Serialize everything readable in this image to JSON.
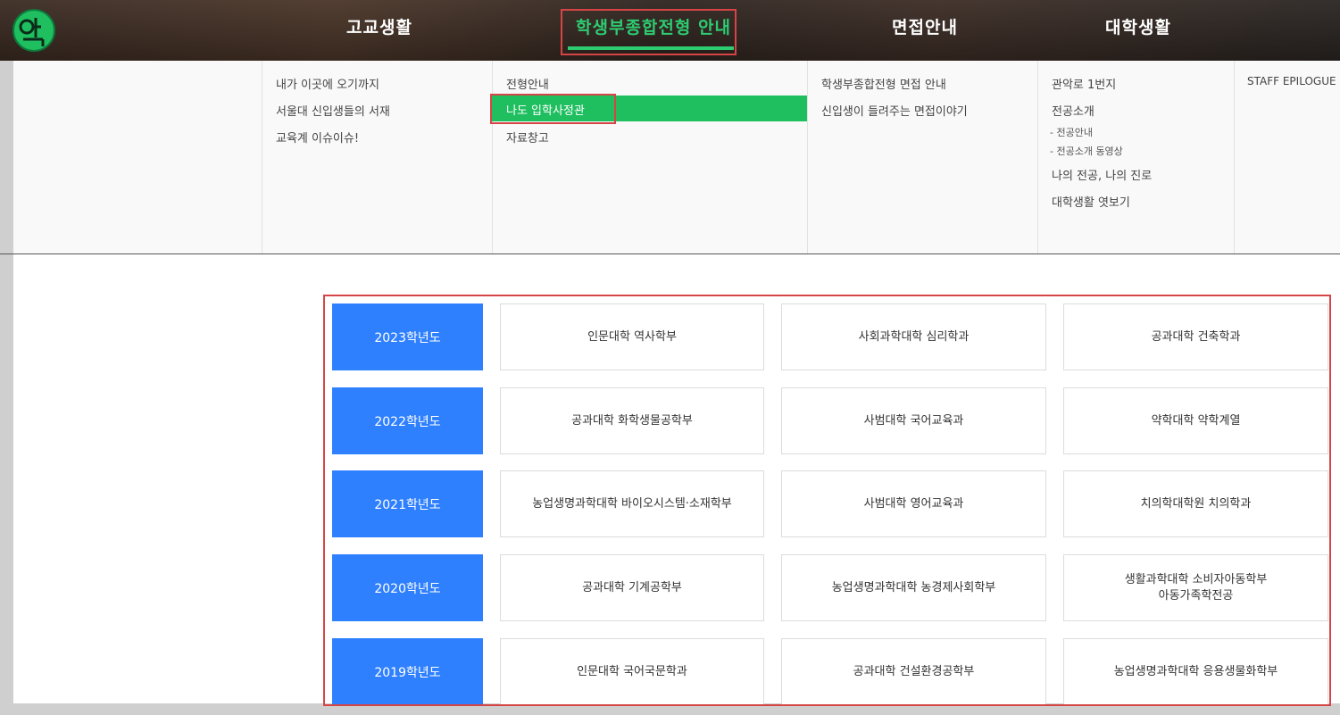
{
  "nav": {
    "items": [
      {
        "label": "고교생활"
      },
      {
        "label": "학생부종합전형 안내"
      },
      {
        "label": "면접안내"
      },
      {
        "label": "대학생활"
      }
    ]
  },
  "dropdown": {
    "col1": [
      "내가 이곳에 오기까지",
      "서울대 신입생들의 서재",
      "교육계 이슈이슈!"
    ],
    "col2": [
      "전형안내",
      "나도 입학사정관",
      "자료창고"
    ],
    "col3": [
      "학생부종합전형 면접 안내",
      "신입생이 들려주는 면접이야기"
    ],
    "col4": {
      "links": [
        "관악로 1번지",
        "전공소개",
        "나의 전공, 나의 진로",
        "대학생활 엿보기"
      ],
      "subs": [
        "- 전공안내",
        "- 전공소개 동영상"
      ]
    },
    "col5": [
      "STAFF EPILOGUE"
    ]
  },
  "table": {
    "rows": [
      {
        "year": "2023학년도",
        "cells": [
          "인문대학  역사학부",
          "사회과학대학  심리학과",
          "공과대학  건축학과"
        ]
      },
      {
        "year": "2022학년도",
        "cells": [
          "공과대학  화학생물공학부",
          "사범대학  국어교육과",
          "약학대학  약학계열"
        ]
      },
      {
        "year": "2021학년도",
        "cells": [
          "농업생명과학대학  바이오시스템·소재학부",
          "사범대학  영어교육과",
          "치의학대학원  치의학과"
        ]
      },
      {
        "year": "2020학년도",
        "cells": [
          "공과대학  기계공학부",
          "농업생명과학대학  농경제사회학부",
          "생활과학대학  소비자아동학부"
        ],
        "cell3_line2": "아동가족학전공"
      },
      {
        "year": "2019학년도",
        "cells": [
          "인문대학  국어국문학과",
          "공과대학  건설환경공학부",
          "농업생명과학대학  응용생물화학부"
        ]
      }
    ]
  },
  "colors": {
    "accent": "#2ecc71",
    "year_bg": "#2f80ff",
    "highlight": "#d64545"
  }
}
